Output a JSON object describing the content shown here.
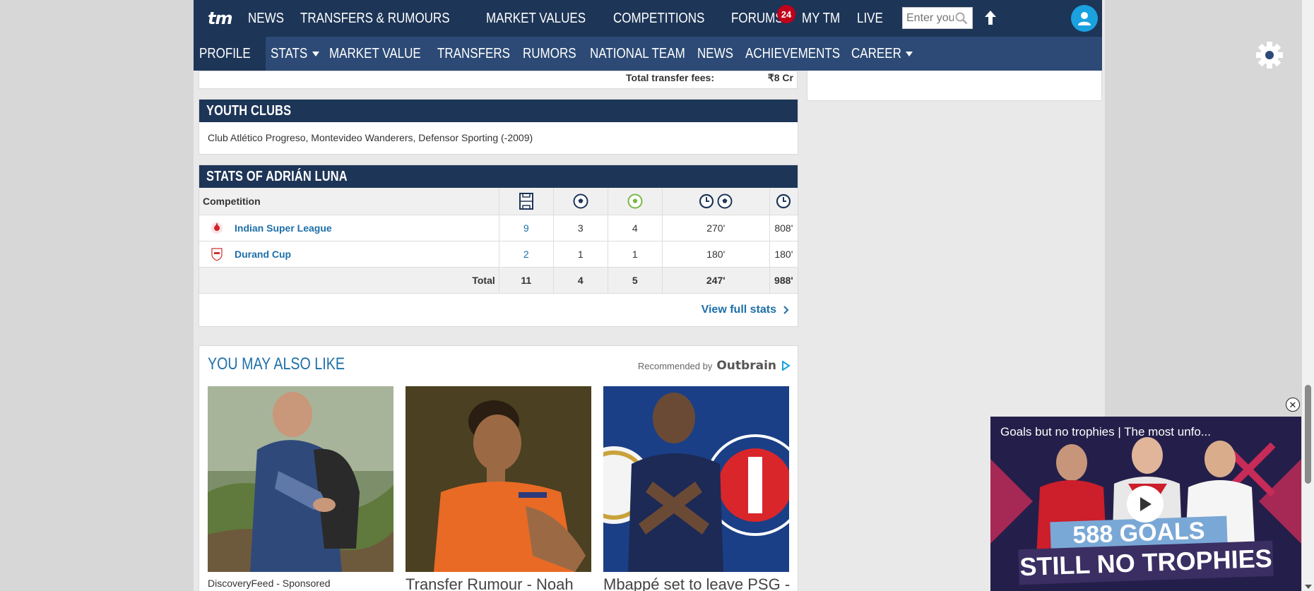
{
  "topnav": {
    "logo": "tm",
    "items": [
      "NEWS",
      "TRANSFERS & RUMOURS",
      "MARKET VALUES",
      "COMPETITIONS",
      "FORUMS",
      "MY TM",
      "LIVE"
    ],
    "live_count": "24",
    "search_placeholder": "Enter your search term",
    "search_visible_text": "Enter your"
  },
  "subnav": {
    "items": [
      "PROFILE",
      "STATS",
      "MARKET VALUE",
      "TRANSFERS",
      "RUMORS",
      "NATIONAL TEAM",
      "NEWS",
      "ACHIEVEMENTS",
      "CAREER"
    ],
    "active": "PROFILE"
  },
  "transfer_summary": {
    "label": "Total transfer fees:",
    "value": "₹8 Cr"
  },
  "youth_clubs": {
    "title": "YOUTH CLUBS",
    "text": "Club Atlético Progreso, Montevideo Wanderers, Defensor Sporting (-2009)"
  },
  "stats": {
    "title": "STATS OF ADRIÁN LUNA",
    "header_competition": "Competition",
    "header_icons": [
      "pitch-icon",
      "ball-icon",
      "green-ball-icon",
      "clock-ball-icon",
      "clock-icon"
    ],
    "rows": [
      {
        "competition": "Indian Super League",
        "apps": "9",
        "goals": "3",
        "assists": "4",
        "min_per_goal": "270'",
        "minutes": "808'"
      },
      {
        "competition": "Durand Cup",
        "apps": "2",
        "goals": "1",
        "assists": "1",
        "min_per_goal": "180'",
        "minutes": "180'"
      }
    ],
    "total": {
      "label": "Total",
      "apps": "11",
      "goals": "4",
      "assists": "5",
      "min_per_goal": "247'",
      "minutes": "988'"
    },
    "view_full": "View full stats"
  },
  "also_like": {
    "title": "YOU MAY ALSO LIKE",
    "recommended_by": "Recommended by",
    "brand": "Outbrain",
    "tiles": [
      {
        "caption": "DiscoveryFeed - Sponsored"
      },
      {
        "caption": "Transfer Rumour - Noah"
      },
      {
        "caption": "Mbappé set to leave PSG - How"
      }
    ]
  },
  "video": {
    "title": "Goals but no trophies | The most unfo...",
    "line1": "588 GOALS",
    "line2": "STILL NO TROPHIES"
  },
  "colors": {
    "navy": "#1d3557",
    "subnav": "#2c4a75",
    "link": "#1d6fa8",
    "badge": "#c0001a"
  }
}
